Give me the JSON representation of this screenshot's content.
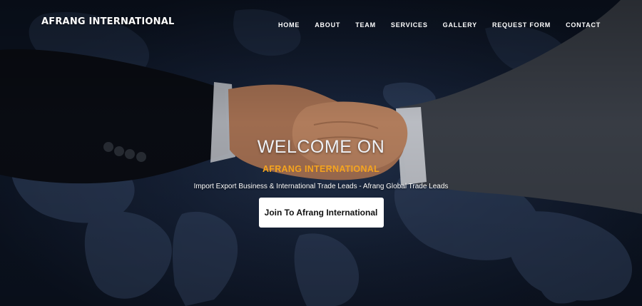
{
  "brand": {
    "name": "AFRANG INTERNATIONAL"
  },
  "nav": {
    "items": [
      {
        "label": "HOME"
      },
      {
        "label": "ABOUT"
      },
      {
        "label": "TEAM"
      },
      {
        "label": "SERVICES"
      },
      {
        "label": "GALLERY"
      },
      {
        "label": "REQUEST FORM"
      },
      {
        "label": "CONTACT"
      }
    ]
  },
  "hero": {
    "title": "WELCOME ON",
    "subtitle": "AFRANG INTERNATIONAL",
    "tagline": "Import Export Business & International Trade Leads - Afrang Global Trade Leads",
    "cta_label": "Join To Afrang International"
  },
  "colors": {
    "accent": "#f5a41e",
    "background": "#17233a",
    "text": "#ffffff",
    "button_bg": "#ffffff",
    "button_text": "#111111"
  },
  "icons": {
    "background_image": "handshake-over-world-map"
  }
}
